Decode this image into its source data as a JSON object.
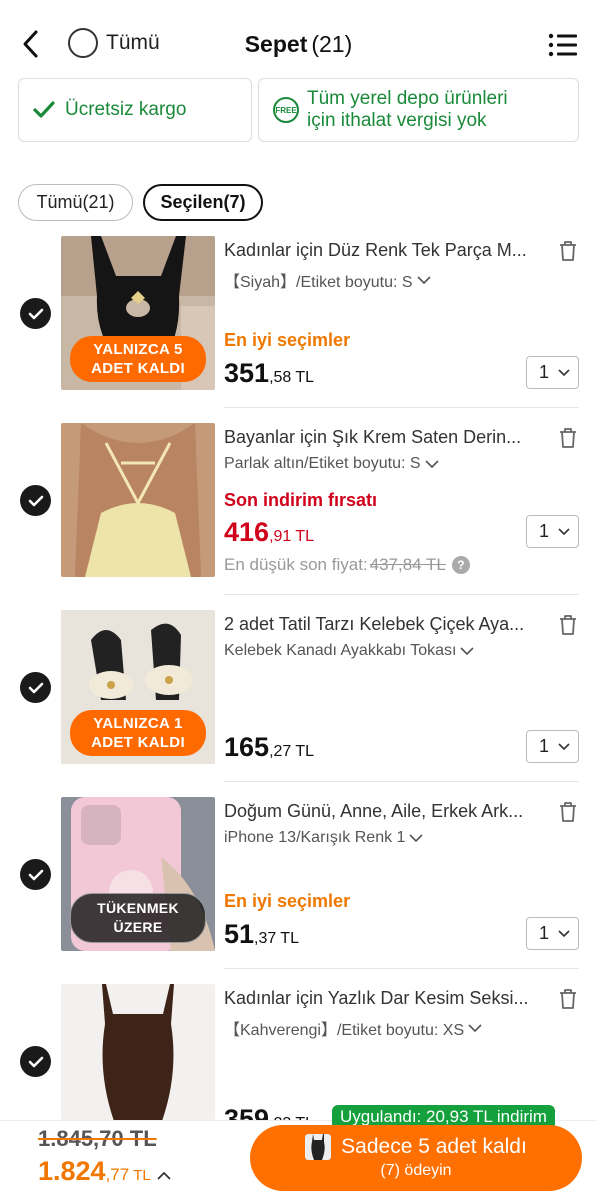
{
  "header": {
    "select_all_label": "Tümü",
    "title": "Sepet",
    "count": "(21)"
  },
  "banners": {
    "free_shipping": "Ücretsiz kargo",
    "free_icon": "FREE",
    "local_warehouse_line1": "Tüm yerel depo ürünleri",
    "local_warehouse_line2": "için ithalat vergisi yok"
  },
  "filters": {
    "all": "Tümü(21)",
    "selected": "Seçilen(7)"
  },
  "items": [
    {
      "title": "Kadınlar için Düz Renk Tek Parça M...",
      "variant": "【Siyah】/Etiket boyutu: S",
      "tag": "En iyi seçimler",
      "price_int": "351",
      "price_dec": ",58",
      "currency": "TL",
      "qty": "1",
      "badge_line1": "YALNIZCA 5",
      "badge_line2": "ADET KALDI"
    },
    {
      "title": "Bayanlar için Şık Krem Saten Derin...",
      "variant": "Parlak altın/Etiket boyutu: S",
      "tag": "Son indirim fırsatı",
      "price_int": "416",
      "price_dec": ",91",
      "currency": "TL",
      "qty": "1",
      "lowest_label": "En düşük son fiyat:",
      "lowest_old": "437,84 TL",
      "info": "?"
    },
    {
      "title": "2 adet Tatil Tarzı Kelebek Çiçek Aya...",
      "variant": "Kelebek Kanadı Ayakkabı Tokası",
      "price_int": "165",
      "price_dec": ",27",
      "currency": "TL",
      "qty": "1",
      "badge_line1": "YALNIZCA 1",
      "badge_line2": "ADET KALDI"
    },
    {
      "title": "Doğum Günü, Anne, Aile, Erkek Ark...",
      "variant": "iPhone 13/Karışık Renk 1",
      "tag": "En iyi seçimler",
      "price_int": "51",
      "price_dec": ",37",
      "currency": "TL",
      "qty": "1",
      "badge": "TÜKENMEK ÜZERE"
    },
    {
      "title": "Kadınlar için Yazlık Dar Kesim Seksi...",
      "variant": "【Kahverengi】/Etiket boyutu: XS",
      "price_int": "359",
      "price_dec": ",23",
      "currency": "TL"
    }
  ],
  "bottom": {
    "applied": "Uygulandı: 20,93 TL indirim",
    "total_old": "1.845,70 TL",
    "total_int": "1.824",
    "total_dec": ",77",
    "currency": "TL",
    "pay_line1": "Sadece 5 adet kaldı",
    "pay_line2": "(7) ödeyin"
  },
  "colors": {
    "accent": "#ff7000",
    "green": "#1a8a3a",
    "sale_red": "#d0021b"
  }
}
